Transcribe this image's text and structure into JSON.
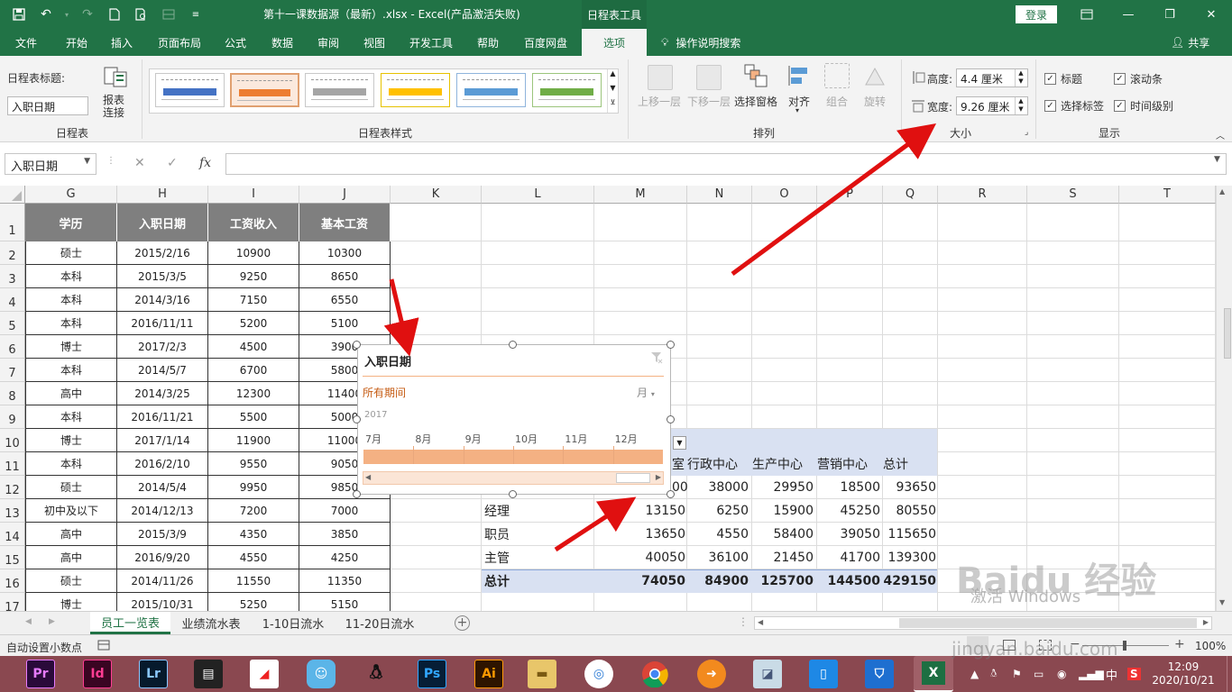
{
  "titlebar": {
    "title": "第十一课数据源（最新）.xlsx  -  Excel(产品激活失败)",
    "context_tab": "日程表工具",
    "login_label": "登录"
  },
  "tabs": [
    {
      "label": "文件"
    },
    {
      "label": "开始"
    },
    {
      "label": "插入"
    },
    {
      "label": "页面布局"
    },
    {
      "label": "公式"
    },
    {
      "label": "数据"
    },
    {
      "label": "审阅"
    },
    {
      "label": "视图"
    },
    {
      "label": "开发工具"
    },
    {
      "label": "帮助"
    },
    {
      "label": "百度网盘"
    },
    {
      "label": "选项"
    }
  ],
  "search_label": "操作说明搜索",
  "share_label": "共享",
  "ribbon": {
    "caption_label": "日程表标题:",
    "caption_value": "入职日期",
    "report_conn_line1": "报表",
    "report_conn_line2": "连接",
    "group_timeline": "日程表",
    "group_styles": "日程表样式",
    "arrange": {
      "bring_forward": "上移一层",
      "send_backward": "下移一层",
      "selection_pane": "选择窗格",
      "align": "对齐",
      "group": "组合",
      "rotate": "旋转",
      "group_label": "排列"
    },
    "size": {
      "height_label": "高度:",
      "height_value": "4.4 厘米",
      "width_label": "宽度:",
      "width_value": "9.26 厘米",
      "group_label": "大小"
    },
    "show": {
      "header": "标题",
      "scrollbar": "滚动条",
      "selection_label": "选择标签",
      "time_level": "时间级别",
      "group_label": "显示"
    }
  },
  "formula_bar": {
    "name_box": "入职日期",
    "formula": ""
  },
  "grid": {
    "columns": [
      "G",
      "H",
      "I",
      "J",
      "K",
      "L",
      "M",
      "N",
      "O",
      "P",
      "Q",
      "R",
      "S",
      "T"
    ],
    "rows": [
      "1",
      "2",
      "3",
      "4",
      "5",
      "6",
      "7",
      "8",
      "9",
      "10",
      "11",
      "12",
      "13",
      "14",
      "15",
      "16",
      "17"
    ],
    "table_headers": [
      "学历",
      "入职日期",
      "工资收入",
      "基本工资"
    ],
    "table_rows": [
      [
        "硕士",
        "2015/2/16",
        "10900",
        "10300"
      ],
      [
        "本科",
        "2015/3/5",
        "9250",
        "8650"
      ],
      [
        "本科",
        "2014/3/16",
        "7150",
        "6550"
      ],
      [
        "本科",
        "2016/11/11",
        "5200",
        "5100"
      ],
      [
        "博士",
        "2017/2/3",
        "4500",
        "3900"
      ],
      [
        "本科",
        "2014/5/7",
        "6700",
        "5800"
      ],
      [
        "高中",
        "2014/3/25",
        "12300",
        "11400"
      ],
      [
        "本科",
        "2016/11/21",
        "5500",
        "5000"
      ],
      [
        "博士",
        "2017/1/14",
        "11900",
        "11000"
      ],
      [
        "本科",
        "2016/2/10",
        "9550",
        "9050"
      ],
      [
        "硕士",
        "2014/5/4",
        "9950",
        "9850"
      ],
      [
        "初中及以下",
        "2014/12/13",
        "7200",
        "7000"
      ],
      [
        "高中",
        "2015/3/9",
        "4350",
        "3850"
      ],
      [
        "高中",
        "2016/9/20",
        "4550",
        "4250"
      ],
      [
        "硕士",
        "2014/11/26",
        "11550",
        "11350"
      ],
      [
        "博士",
        "2015/10/31",
        "5250",
        "5150"
      ]
    ]
  },
  "pivot": {
    "header_partial": "室",
    "col_headers": [
      "行政中心",
      "生产中心",
      "营销中心",
      "总计"
    ],
    "first_row_partial": "00",
    "first_row": [
      "38000",
      "29950",
      "18500",
      "93650"
    ],
    "rows": [
      {
        "label": "经理",
        "values": [
          "13150",
          "6250",
          "15900",
          "45250",
          "80550"
        ]
      },
      {
        "label": "职员",
        "values": [
          "13650",
          "4550",
          "58400",
          "39050",
          "115650"
        ]
      },
      {
        "label": "主管",
        "values": [
          "40050",
          "36100",
          "21450",
          "41700",
          "139300"
        ]
      }
    ],
    "total": {
      "label": "总计",
      "values": [
        "74050",
        "84900",
        "125700",
        "144500",
        "429150"
      ]
    }
  },
  "timeline": {
    "title": "入职日期",
    "period_label": "所有期间",
    "level_label": "月",
    "year": "2017",
    "months": [
      "7月",
      "8月",
      "9月",
      "10月",
      "11月",
      "12月"
    ],
    "bar_color": "#f4b183"
  },
  "sheets": [
    "员工一览表",
    "业绩流水表",
    "1-10日流水",
    "11-20日流水"
  ],
  "statusbar": {
    "left_text": "自动设置小数点",
    "zoom": "100%"
  },
  "taskbar": {
    "apps": [
      "Pr",
      "Id",
      "Lr",
      "",
      "",
      "",
      "",
      "Ps",
      "Ai",
      "",
      "",
      "",
      "",
      "",
      "",
      "",
      "",
      "X"
    ],
    "tray_ime": "中",
    "tray_time": "12:09",
    "tray_date": "2020/10/21"
  },
  "overlay": {
    "watermark": "Baidu 经验",
    "watermark_url": "jingyan.baidu.com",
    "activate_text": "激活 Windows"
  },
  "colors": {
    "excel_green": "#217346",
    "table_header_gray": "#7f7f7f",
    "pivot_header_blue": "#d9e1f2",
    "timeline_orange": "#f4b183",
    "arrow_red": "#e01010"
  }
}
